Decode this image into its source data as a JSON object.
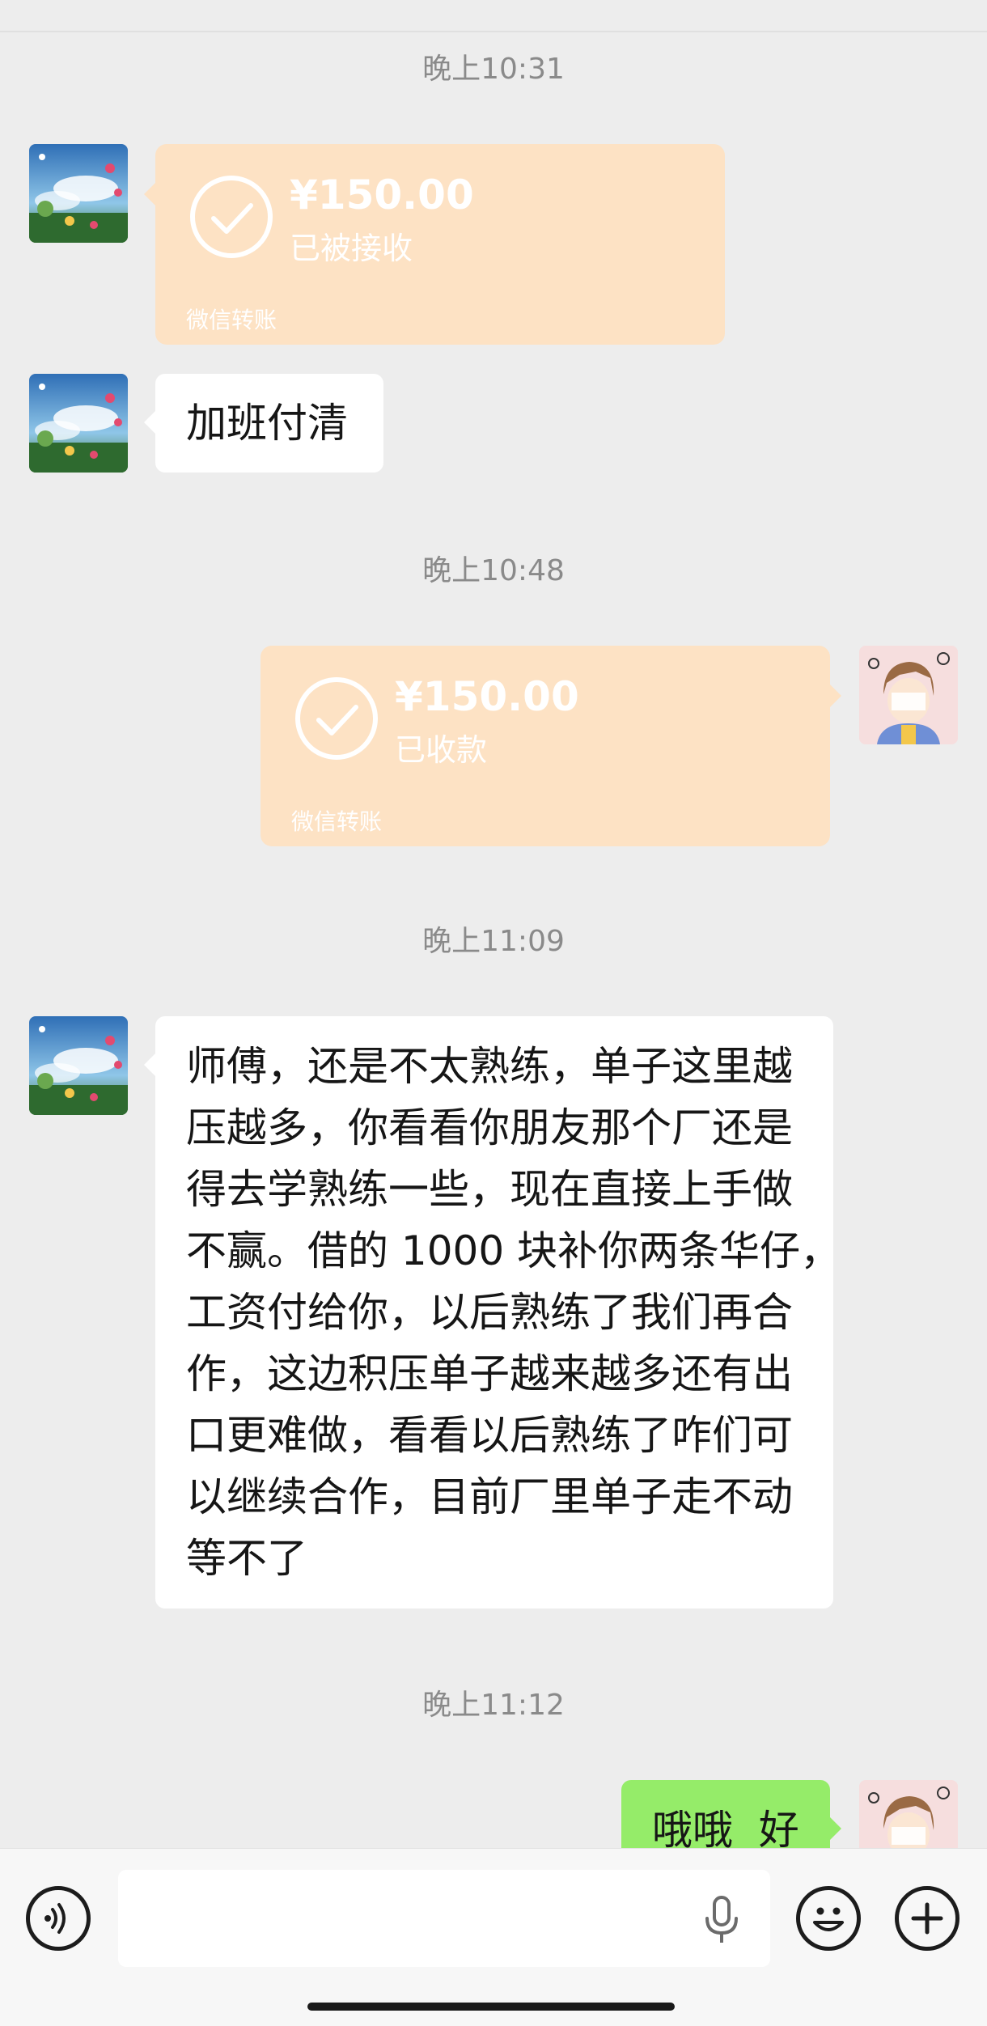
{
  "times": [
    "晚上10:31",
    "晚上10:48",
    "晚上11:09",
    "晚上11:12"
  ],
  "transfers": [
    {
      "amount": "¥150.00",
      "status": "已被接收",
      "brand": "微信转账"
    },
    {
      "amount": "¥150.00",
      "status": "已收款",
      "brand": "微信转账"
    }
  ],
  "messages": {
    "m1": "加班付清",
    "m2_lines": [
      "师傅，还是不太熟练，单子这里越",
      "压越多，你看看你朋友那个厂还是",
      "得去学熟练一些，现在直接上手做",
      "不赢。借的 1000 块补你两条华仔，",
      "工资付给你，以后熟练了我们再合",
      "作，这边积压单子越来越多还有出",
      "口更难做，看看以后熟练了咋们可",
      "以继续合作，目前厂里单子走不动",
      "等不了"
    ],
    "m3": "哦哦  好"
  },
  "input": {
    "placeholder": ""
  },
  "icons": {
    "voice": "voice-icon",
    "mic": "mic-icon",
    "emoji": "emoji-icon",
    "add": "plus-icon"
  },
  "colors": {
    "transfer_bg": "#fde2c4",
    "my_bubble": "#95ec69",
    "their_bubble": "#ffffff",
    "bg": "#ededed"
  }
}
